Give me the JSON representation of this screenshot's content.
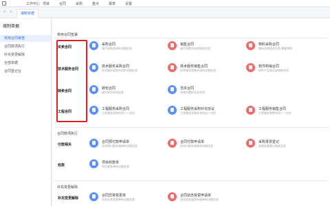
{
  "topbar": {
    "menu": [
      "工作中心",
      "项目",
      "合同",
      "采购",
      "盘点",
      "报表",
      "设置"
    ]
  },
  "tabbar": {
    "back": "<",
    "forward": ">",
    "active_tab": "填制单据"
  },
  "sidebar": {
    "title": "填制单据",
    "items": [
      {
        "label": "常用合同审查",
        "active": true
      },
      {
        "label": "合同款项执行",
        "active": false
      },
      {
        "label": "补充变更解除",
        "active": false
      },
      {
        "label": "全部单据",
        "active": false
      },
      {
        "label": "合同登记台",
        "active": false
      }
    ]
  },
  "sections": [
    {
      "title": "常用合同签署"
    },
    {
      "title": "合同款项执行"
    },
    {
      "title": "补充变更解除"
    }
  ],
  "categories": [
    "买卖合同",
    "技术服务合同",
    "转卖合同",
    "工程合同",
    "付款相关",
    "收款",
    "补充变更解除"
  ],
  "cards": [
    {
      "name": "采购合同",
      "desc": "填写采购合同的详细信息",
      "color": "blue"
    },
    {
      "name": "销售合同",
      "desc": "填写销售合同的相关信息",
      "color": "red"
    },
    {
      "name": "物料采购合同",
      "desc": "物料采购相关信息,需要审核",
      "color": "red"
    },
    {
      "name": "技术服务采购合同",
      "desc": "技术服务采购合同的详细信息",
      "color": "blue"
    },
    {
      "name": "技术服务销售合同",
      "desc": "技术服务销售合同的详细信息",
      "color": "red"
    },
    {
      "name": "软件购销合同",
      "desc": "软件产品购买或销售合同",
      "color": "red"
    },
    {
      "name": "转包合同",
      "desc": "填写转包合同信息",
      "color": "blue"
    },
    {
      "name": "范本合同",
      "desc": "系统内置的范本合同",
      "color": "blue"
    },
    {
      "name": "工程服务采购合同",
      "desc": "工程服务采购合同一一对应",
      "color": "blue"
    },
    {
      "name": "工程服务采购补充协议",
      "desc": "工程服务采购补充协议一对应",
      "color": "blue"
    },
    {
      "name": "工程服务销售合同",
      "desc": "工程服务销售合同一一对应",
      "color": "red"
    },
    {
      "name": "合同预付款申请单",
      "desc": "合同预付款申请单的详细信息",
      "color": "blue"
    },
    {
      "name": "合同付款申请单",
      "desc": "合同付款申请单的详细信息",
      "color": "red"
    },
    {
      "name": "采购发票登记",
      "desc": "采购发票登记相关信息",
      "color": "red"
    },
    {
      "name": "项目收款单",
      "desc": "项目收款单的详细信息",
      "color": "blue"
    },
    {
      "name": "合同异常变更单",
      "desc": "合同异常变更单的详细信息",
      "color": "blue"
    },
    {
      "name": "合同状态变更申请单",
      "desc": "合同状态变更申请单的详细信息",
      "color": "red"
    }
  ],
  "colors": {
    "accent": "#2f6fe4",
    "highlight": "#e02020",
    "icon_blue": "#5b8ff9",
    "icon_red": "#f06a6a"
  }
}
